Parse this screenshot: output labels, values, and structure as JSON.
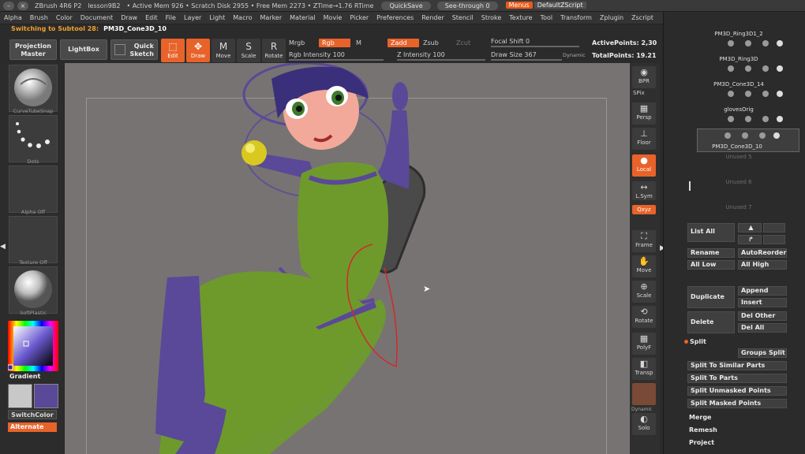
{
  "titlebar": {
    "app": "ZBrush 4R6 P2",
    "doc": "lesson9B2",
    "memory": "• Active Mem 926 • Scratch Disk 2955 • Free Mem 2273 • ZTime→1.76 RTime",
    "quicksave": "QuickSave",
    "see_through": "See-through  0",
    "menus": "Menus",
    "script": "DefaultZScript"
  },
  "menubar": [
    "Alpha",
    "Brush",
    "Color",
    "Document",
    "Draw",
    "Edit",
    "File",
    "Layer",
    "Light",
    "Macro",
    "Marker",
    "Material",
    "Movie",
    "Picker",
    "Preferences",
    "Render",
    "Stencil",
    "Stroke",
    "Texture",
    "Tool",
    "Transform",
    "Zplugin",
    "Zscript"
  ],
  "status": {
    "text": "Switching to Subtool 28:",
    "value": "PM3D_Cone3D_10"
  },
  "toolbar": {
    "projection_master": "Projection Master",
    "lightbox": "LightBox",
    "quick_sketch": "Quick Sketch",
    "edit": "Edit",
    "draw": "Draw",
    "move": "Move",
    "scale": "Scale",
    "rotate": "Rotate",
    "mrgb": "Mrgb",
    "rgb": "Rgb",
    "m": "M",
    "zadd": "Zadd",
    "zsub": "Zsub",
    "zcut": "Zcut",
    "rgb_intensity": "Rgb Intensity 100",
    "z_intensity": "Z Intensity 100",
    "focal_shift": "Focal Shift 0",
    "draw_size": "Draw Size 367",
    "dynamic": "Dynamic",
    "active_points": "ActivePoints: 2,30",
    "total_points": "TotalPoints: 19.21"
  },
  "leftshelf": {
    "brush": "CurveTubeSnap",
    "stroke": "Dots",
    "alpha": "Alpha Off",
    "texture": "Texture Off",
    "material": "SoftPlastic",
    "gradient": "Gradient",
    "switch_color": "SwitchColor",
    "alternate": "Alternate"
  },
  "rightshelf": {
    "bpr": "BPR",
    "spix": "SPix",
    "persp": "Persp",
    "floor": "Floor",
    "local": "Local",
    "lsym": "L.Sym",
    "xyz": "Qxyz",
    "frame": "Frame",
    "move": "Move",
    "scale": "Scale",
    "rotate": "Rotate",
    "polyf": "PolyF",
    "transp": "Transp",
    "dynamic": "Dynamic",
    "solo": "Solo"
  },
  "subtools": [
    {
      "name": "PM3D_Ring3D1_2",
      "dim": false
    },
    {
      "name": "PM3D_Ring3D",
      "dim": false
    },
    {
      "name": "PM3D_Cone3D_14",
      "dim": false
    },
    {
      "name": "glovesOrig",
      "dim": false
    },
    {
      "name": "PM3D_Cone3D_10",
      "dim": false
    },
    {
      "name": "Unused 5",
      "dim": true
    },
    {
      "name": "Unused 6",
      "dim": true
    },
    {
      "name": "Unused 7",
      "dim": true
    }
  ],
  "panel": {
    "list_all": "List All",
    "rename": "Rename",
    "auto_reorder": "AutoReorder",
    "all_low": "All Low",
    "all_high": "All High",
    "duplicate": "Duplicate",
    "append": "Append",
    "insert": "Insert",
    "delete": "Delete",
    "del_other": "Del Other",
    "del_all": "Del All",
    "split": "Split",
    "groups_split": "Groups Split",
    "split_similar": "Split To Similar Parts",
    "split_parts": "Split To Parts",
    "split_unmasked": "Split Unmasked Points",
    "split_masked": "Split Masked Points",
    "merge": "Merge",
    "remesh": "Remesh",
    "project": "Project"
  },
  "colors": {
    "accent": "#e8632a",
    "bodysuit": "#6e9a2c",
    "suit_purple": "#5a4898",
    "viewport": "#777373"
  }
}
